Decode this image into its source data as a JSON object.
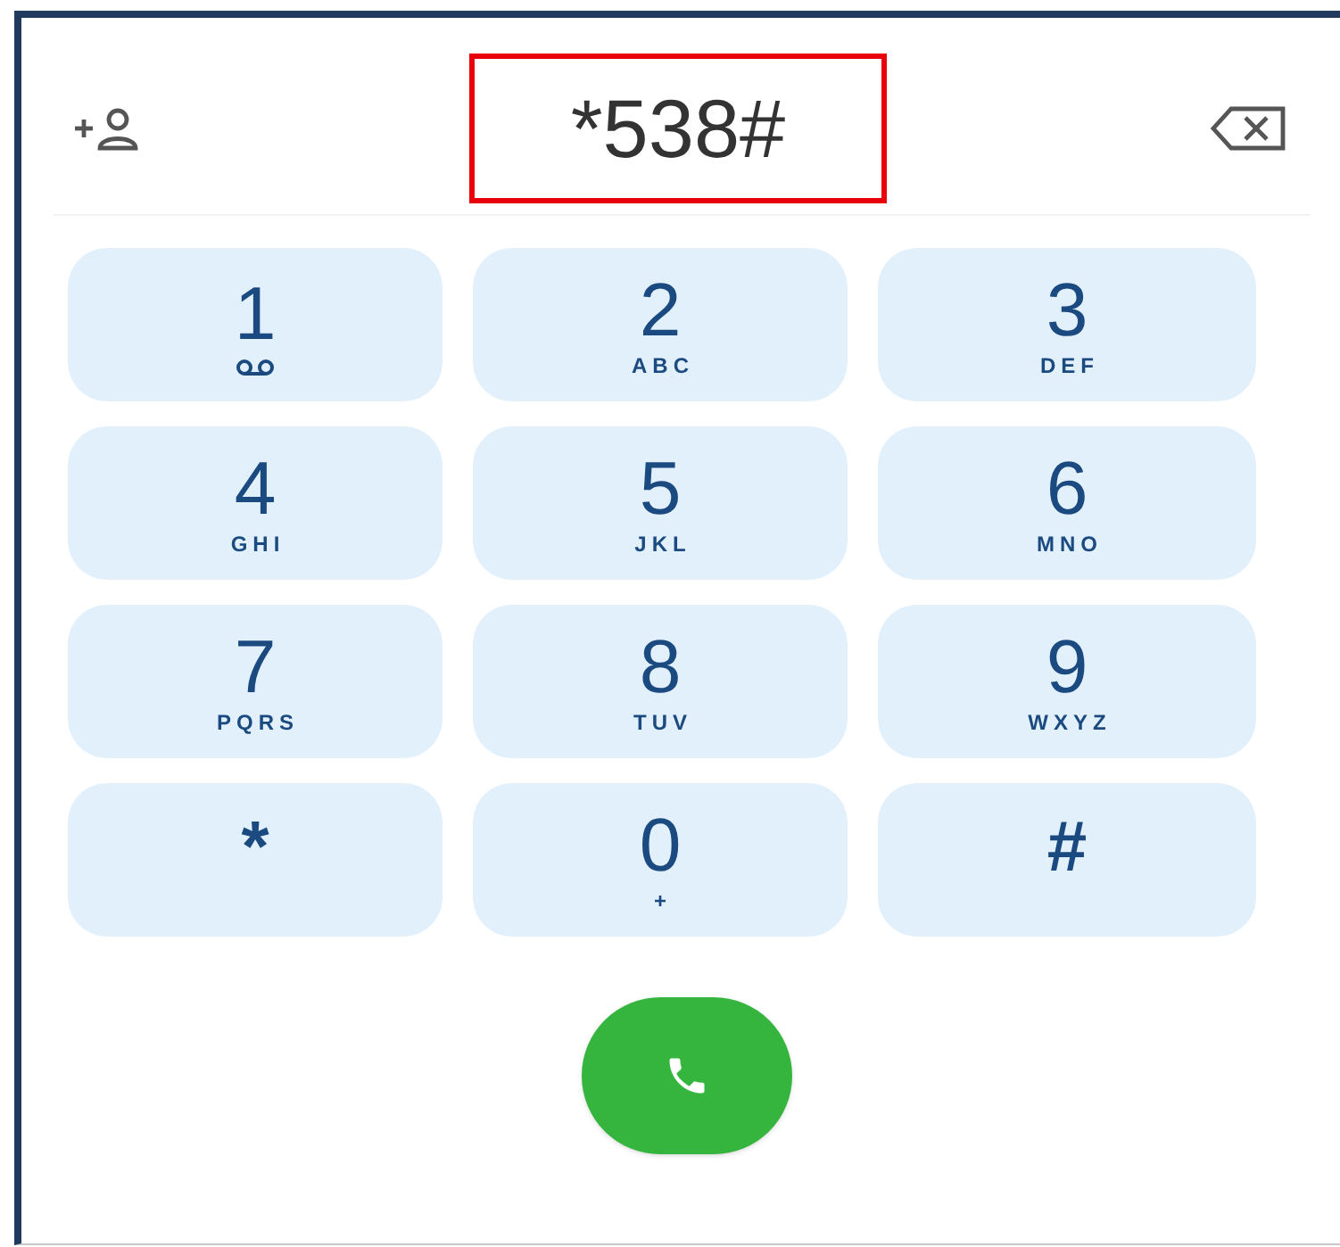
{
  "dialed_number": {
    "value": "*538#",
    "highlighted": true
  },
  "keys": [
    {
      "kind": "voicemail",
      "digit": "1"
    },
    {
      "kind": "letters",
      "digit": "2",
      "letters": "ABC"
    },
    {
      "kind": "letters",
      "digit": "3",
      "letters": "DEF"
    },
    {
      "kind": "letters",
      "digit": "4",
      "letters": "GHI"
    },
    {
      "kind": "letters",
      "digit": "5",
      "letters": "JKL"
    },
    {
      "kind": "letters",
      "digit": "6",
      "letters": "MNO"
    },
    {
      "kind": "letters",
      "digit": "7",
      "letters": "PQRS"
    },
    {
      "kind": "letters",
      "digit": "8",
      "letters": "TUV"
    },
    {
      "kind": "letters",
      "digit": "9",
      "letters": "WXYZ"
    },
    {
      "kind": "plain",
      "digit": "*"
    },
    {
      "kind": "letters",
      "digit": "0",
      "letters": "+"
    },
    {
      "kind": "plain",
      "digit": "#"
    }
  ]
}
